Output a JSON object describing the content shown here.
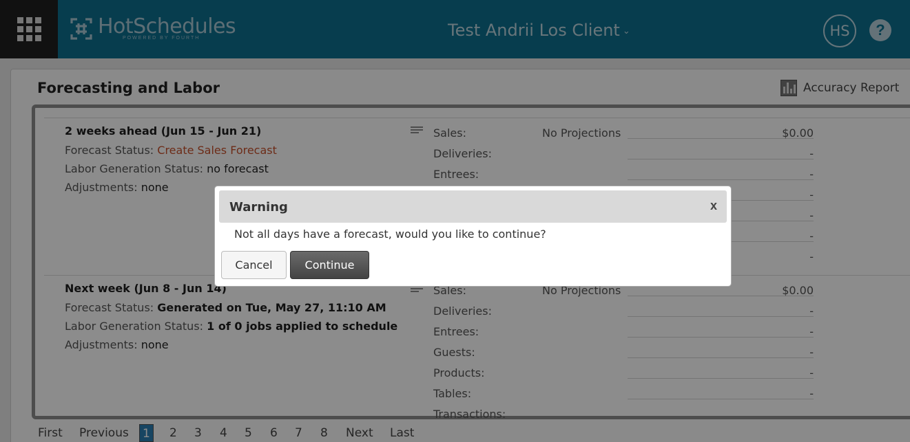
{
  "header": {
    "logo_text": "HotSchedules",
    "logo_tagline": "POWERED BY FOURTH",
    "client_name": "Test Andrii Los Client",
    "client_chevron": "⌄",
    "avatar_initials": "HS",
    "help_label": "?"
  },
  "page": {
    "title": "Forecasting and Labor",
    "accuracy_report_label": "Accuracy Report"
  },
  "weeks": [
    {
      "title": "2 weeks ahead (Jun 15 - Jun 21)",
      "forecast_status_label": "Forecast Status:",
      "forecast_status_value": "Create Sales Forecast",
      "labor_status_label": "Labor Generation Status:",
      "labor_status_value": "no forecast",
      "adjustments_label": "Adjustments:",
      "adjustments_value": "none",
      "projections": [
        {
          "label": "Sales:",
          "note": "No Projections",
          "amount": "$0.00"
        },
        {
          "label": "Deliveries:",
          "note": "",
          "amount": "-"
        },
        {
          "label": "Entrees:",
          "note": "",
          "amount": "-"
        },
        {
          "label": "",
          "note": "",
          "amount": "-"
        },
        {
          "label": "",
          "note": "",
          "amount": "-"
        },
        {
          "label": "",
          "note": "",
          "amount": "-"
        },
        {
          "label": "",
          "note": "",
          "amount": "-"
        }
      ]
    },
    {
      "title": "Next week (Jun 8 - Jun 14)",
      "forecast_status_label": "Forecast Status:",
      "forecast_status_value": "Generated on Tue, May 27, 11:10 AM",
      "labor_status_label": "Labor Generation Status:",
      "labor_status_value": "1 of 0 jobs applied to schedule",
      "adjustments_label": "Adjustments:",
      "adjustments_value": "none",
      "projections": [
        {
          "label": "Sales:",
          "note": "No Projections",
          "amount": "$0.00"
        },
        {
          "label": "Deliveries:",
          "note": "",
          "amount": "-"
        },
        {
          "label": "Entrees:",
          "note": "",
          "amount": "-"
        },
        {
          "label": "Guests:",
          "note": "",
          "amount": "-"
        },
        {
          "label": "Products:",
          "note": "",
          "amount": "-"
        },
        {
          "label": "Tables:",
          "note": "",
          "amount": "-"
        },
        {
          "label": "Transactions:",
          "note": "",
          "amount": ""
        }
      ]
    }
  ],
  "pagination": {
    "first": "First",
    "previous": "Previous",
    "pages": [
      "1",
      "2",
      "3",
      "4",
      "5",
      "6",
      "7",
      "8"
    ],
    "active_page": "1",
    "next": "Next",
    "last": "Last"
  },
  "dialog": {
    "title": "Warning",
    "close_label": "x",
    "message": "Not all days have a forecast, would you like to continue?",
    "cancel_label": "Cancel",
    "continue_label": "Continue"
  },
  "colors": {
    "header_bg": "#0e6f8f",
    "link_orange": "#c7512c",
    "active_page": "#2b7fb3"
  }
}
